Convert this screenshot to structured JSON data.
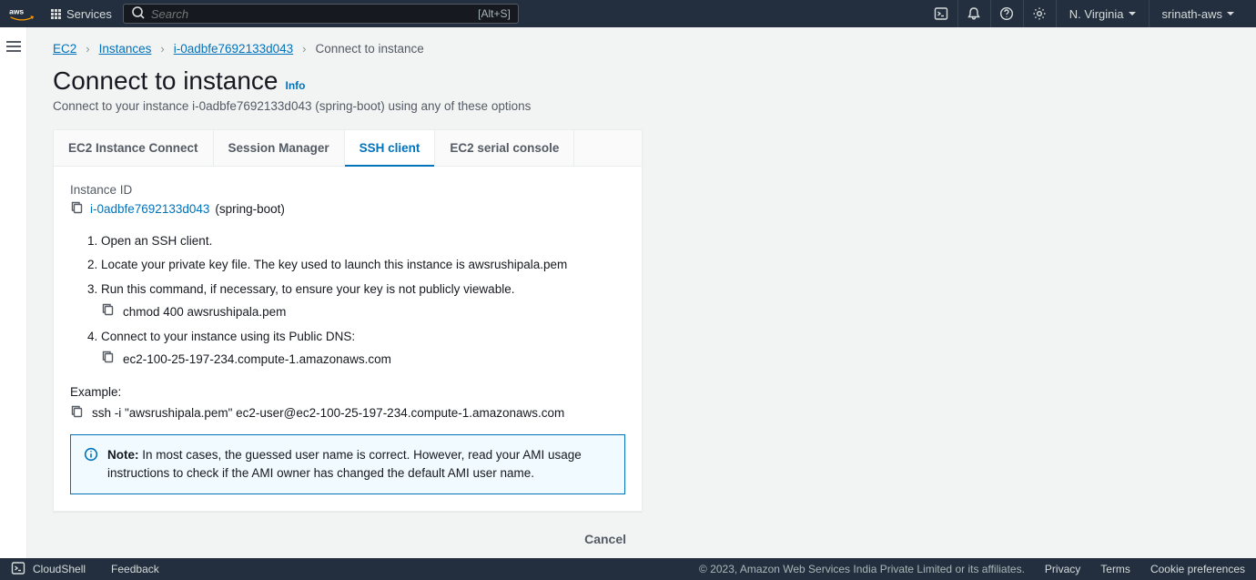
{
  "header": {
    "services_label": "Services",
    "search_placeholder": "Search",
    "search_shortcut": "[Alt+S]",
    "region": "N. Virginia",
    "user": "srinath-aws"
  },
  "breadcrumb": {
    "items": [
      "EC2",
      "Instances",
      "i-0adbfe7692133d043"
    ],
    "current": "Connect to instance"
  },
  "page": {
    "title": "Connect to instance",
    "info": "Info",
    "desc": "Connect to your instance i-0adbfe7692133d043 (spring-boot) using any of these options"
  },
  "tabs": [
    "EC2 Instance Connect",
    "Session Manager",
    "SSH client",
    "EC2 serial console"
  ],
  "active_tab_index": 2,
  "ssh": {
    "instance_id_label": "Instance ID",
    "instance_id": "i-0adbfe7692133d043",
    "instance_name": "(spring-boot)",
    "steps": [
      "Open an SSH client.",
      "Locate your private key file. The key used to launch this instance is awsrushipala.pem",
      "Run this command, if necessary, to ensure your key is not publicly viewable.",
      "Connect to your instance using its Public DNS:"
    ],
    "chmod_cmd": "chmod 400 awsrushipala.pem",
    "public_dns": "ec2-100-25-197-234.compute-1.amazonaws.com",
    "example_label": "Example:",
    "example_cmd": "ssh -i \"awsrushipala.pem\" ec2-user@ec2-100-25-197-234.compute-1.amazonaws.com",
    "note_label": "Note:",
    "note_text": " In most cases, the guessed user name is correct. However, read your AMI usage instructions to check if the AMI owner has changed the default AMI user name."
  },
  "actions": {
    "cancel": "Cancel"
  },
  "footer": {
    "cloudshell": "CloudShell",
    "feedback": "Feedback",
    "copyright": "© 2023, Amazon Web Services India Private Limited or its affiliates.",
    "links": [
      "Privacy",
      "Terms",
      "Cookie preferences"
    ]
  }
}
